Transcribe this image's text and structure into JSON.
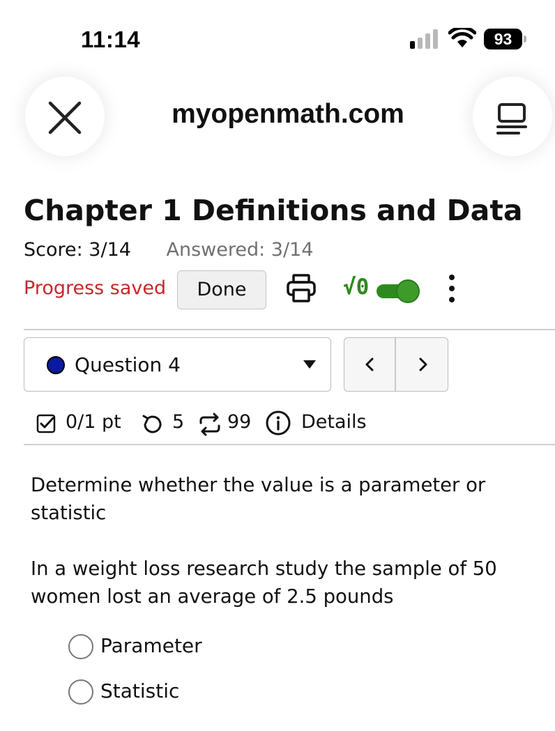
{
  "status_bar": {
    "time": "11:14",
    "battery": "93"
  },
  "browser": {
    "url": "myopenmath.com"
  },
  "assessment": {
    "title": "Chapter 1 Definitions and Data",
    "score": "Score: 3/14",
    "answered": "Answered: 3/14",
    "progress_status": "Progress saved",
    "done_label": "Done",
    "math_toggle_label": "√0",
    "math_toggle_on": true
  },
  "question_nav": {
    "selected": "Question 4",
    "status_color": "#0a1aa0"
  },
  "question_meta": {
    "points": "0/1 pt",
    "retries": "5",
    "regens": "99",
    "details_label": "Details"
  },
  "question": {
    "prompt_1": "Determine whether the value is a parameter or statistic",
    "prompt_2": "In a weight loss research study the sample of 50 women lost an average of 2.5 pounds",
    "choices": [
      "Parameter",
      "Statistic"
    ]
  },
  "colors": {
    "accent_green": "#2e8a1f",
    "error_red": "#c6282b"
  }
}
